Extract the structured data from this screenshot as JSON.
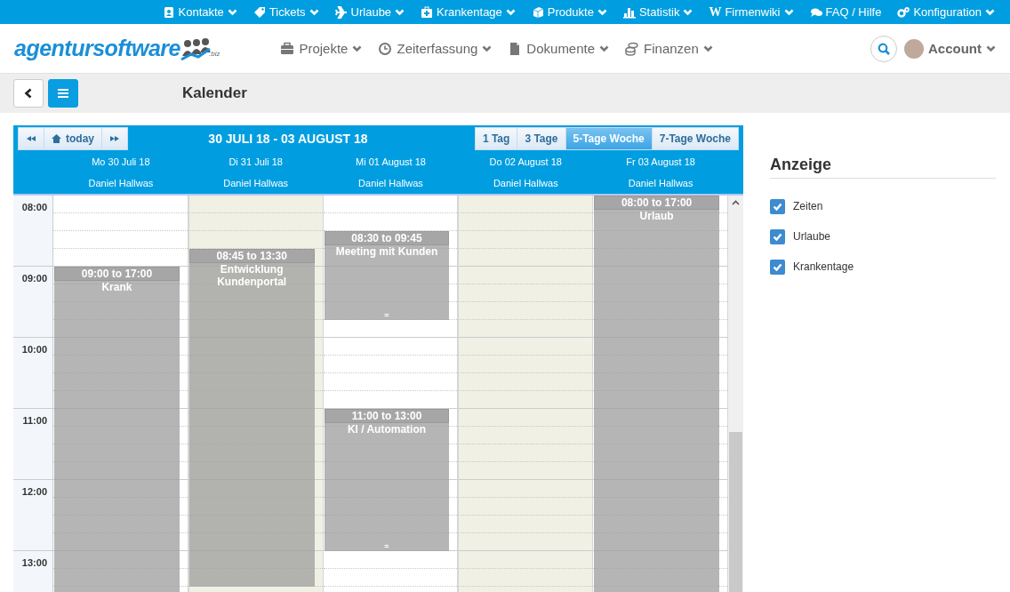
{
  "top_menu": [
    {
      "label": "Kontakte",
      "caret": true
    },
    {
      "label": "Tickets",
      "caret": true
    },
    {
      "label": "Urlaube",
      "caret": true
    },
    {
      "label": "Krankentage",
      "caret": true
    },
    {
      "label": "Produkte",
      "caret": true
    },
    {
      "label": "Statistik",
      "caret": true
    },
    {
      "label": "Firmenwiki",
      "glyph": "W",
      "caret": true
    },
    {
      "label": "FAQ / Hilfe",
      "caret": false
    },
    {
      "label": "Konfiguration",
      "caret": true
    }
  ],
  "logo": {
    "text": "agentursoftware",
    "suffix": ".biz"
  },
  "main_nav": [
    {
      "label": "Projekte"
    },
    {
      "label": "Zeiterfassung"
    },
    {
      "label": "Dokumente"
    },
    {
      "label": "Finanzen"
    }
  ],
  "account": {
    "label": "Account"
  },
  "page_title": "Kalender",
  "calendar": {
    "today": "today",
    "range": "30 JULI 18 - 03 AUGUST 18",
    "views": [
      {
        "label": "1 Tag",
        "selected": false
      },
      {
        "label": "3 Tage",
        "selected": false
      },
      {
        "label": "5-Tage Woche",
        "selected": true
      },
      {
        "label": "7-Tage Woche",
        "selected": false
      }
    ],
    "hours": [
      "08:00",
      "09:00",
      "10:00",
      "11:00",
      "12:00",
      "13:00"
    ],
    "days": [
      {
        "date": "Mo 30 Juli 18",
        "person": "Daniel Hallwas",
        "shaded": false,
        "events": [
          {
            "time": "09:00 to 17:00",
            "title": "Krank"
          }
        ]
      },
      {
        "date": "Di 31 Juli 18",
        "person": "Daniel Hallwas",
        "shaded": true,
        "events": [
          {
            "time": "08:45 to 13:30",
            "title": "Entwicklung Kundenportal"
          }
        ]
      },
      {
        "date": "Mi 01 August 18",
        "person": "Daniel Hallwas",
        "shaded": false,
        "events": [
          {
            "time": "08:30 to 09:45",
            "title": "Meeting mit Kunden",
            "handle": "="
          },
          {
            "time": "11:00 to 13:00",
            "title": "KI / Automation",
            "handle": "="
          }
        ]
      },
      {
        "date": "Do 02 August 18",
        "person": "Daniel Hallwas",
        "shaded": true
      },
      {
        "date": "Fr 03 August 18",
        "person": "Daniel Hallwas",
        "shaded": false,
        "events": [
          {
            "time": "08:00 to 17:00",
            "title": "Urlaub"
          }
        ]
      }
    ]
  },
  "sidebar": {
    "title": "Anzeige",
    "filters": [
      {
        "label": "Zeiten",
        "checked": true
      },
      {
        "label": "Urlaube",
        "checked": true
      },
      {
        "label": "Krankentage",
        "checked": true
      }
    ]
  }
}
